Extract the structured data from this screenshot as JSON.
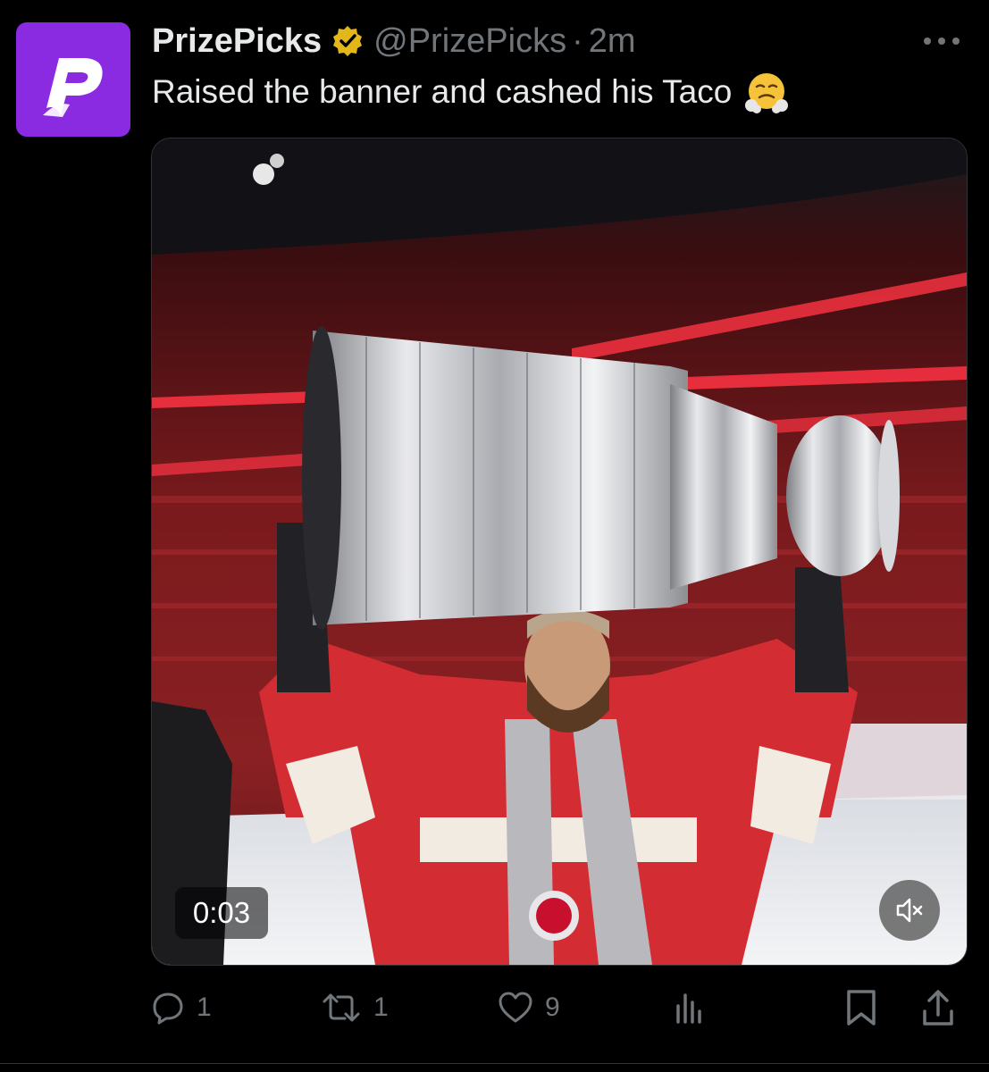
{
  "tweet": {
    "avatar_icon": "prizepicks-logo-icon",
    "display_name": "PrizePicks",
    "verified_icon": "verified-gold-badge-icon",
    "handle": "@PrizePicks",
    "separator": "·",
    "time": "2m",
    "more_icon": "more-horizontal-icon",
    "text": "Raised the banner and cashed his Taco",
    "emoji_icon": "face-with-steam-from-nose-emoji-icon"
  },
  "media": {
    "type": "video",
    "image_icon": "video-player-frame-image",
    "timestamp": "0:03",
    "mute_icon": "volume-muted-icon"
  },
  "actions": {
    "reply": {
      "icon": "reply-icon",
      "count": "1"
    },
    "repost": {
      "icon": "repost-icon",
      "count": "1"
    },
    "like": {
      "icon": "like-heart-icon",
      "count": "9"
    },
    "views": {
      "icon": "views-chart-icon"
    },
    "bookmark": {
      "icon": "bookmark-icon"
    },
    "share": {
      "icon": "share-icon"
    }
  },
  "colors": {
    "background": "#000000",
    "primary_text": "#e7e9ea",
    "secondary_text": "#71767b",
    "brand_purple": "#8a2be2",
    "verified_gold": "#e2b719",
    "arena_red": "#e0202a"
  }
}
